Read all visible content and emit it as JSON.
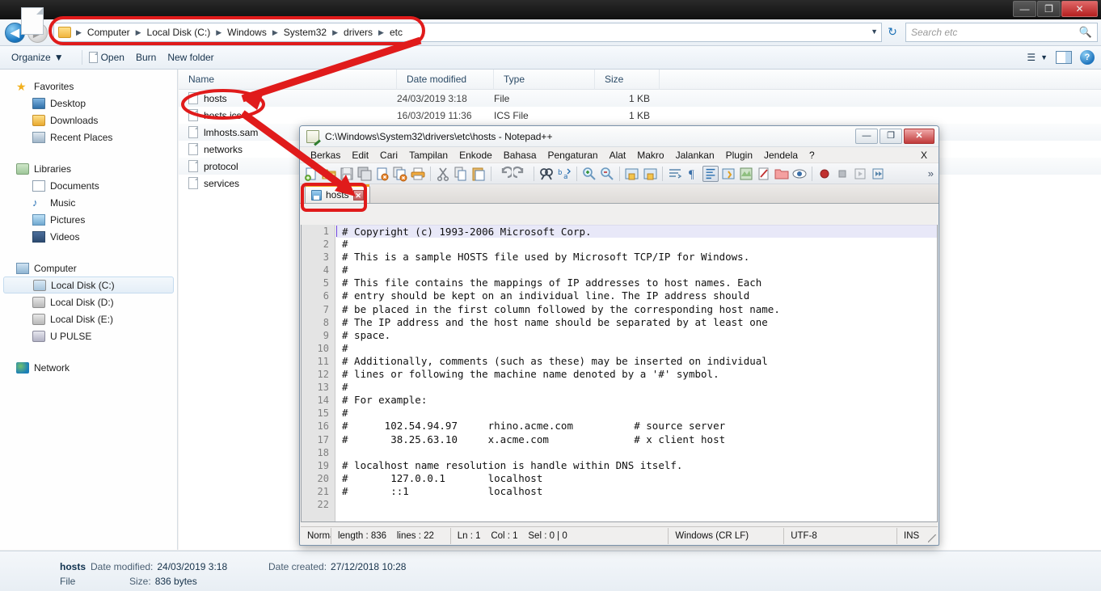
{
  "explorer": {
    "window_controls": {
      "minimize": "—",
      "maximize": "❐",
      "close": "✕"
    },
    "breadcrumb": [
      "Computer",
      "Local Disk (C:)",
      "Windows",
      "System32",
      "drivers",
      "etc"
    ],
    "search": {
      "placeholder": "Search etc"
    },
    "toolbar": {
      "organize": "Organize",
      "organize_caret": "▼",
      "open": "Open",
      "burn": "Burn",
      "new_folder": "New folder"
    },
    "sidebar": {
      "groups": [
        {
          "header": "Favorites",
          "icon": "star-icon",
          "items": [
            {
              "label": "Desktop",
              "icon": "desktop-icon"
            },
            {
              "label": "Downloads",
              "icon": "downloads-icon"
            },
            {
              "label": "Recent Places",
              "icon": "recent-places-icon"
            }
          ]
        },
        {
          "header": "Libraries",
          "icon": "libraries-icon",
          "items": [
            {
              "label": "Documents",
              "icon": "documents-icon"
            },
            {
              "label": "Music",
              "icon": "music-icon"
            },
            {
              "label": "Pictures",
              "icon": "pictures-icon"
            },
            {
              "label": "Videos",
              "icon": "videos-icon"
            }
          ]
        },
        {
          "header": "Computer",
          "icon": "computer-icon",
          "items": [
            {
              "label": "Local Disk (C:)",
              "icon": "hdd-system-icon",
              "selected": true
            },
            {
              "label": "Local Disk (D:)",
              "icon": "hdd-icon"
            },
            {
              "label": "Local Disk (E:)",
              "icon": "hdd-icon"
            },
            {
              "label": "U PULSE",
              "icon": "usb-drive-icon"
            }
          ]
        },
        {
          "header": "Network",
          "icon": "network-icon",
          "items": []
        }
      ]
    },
    "columns": [
      "Name",
      "Date modified",
      "Type",
      "Size"
    ],
    "files": [
      {
        "name": "hosts",
        "date": "24/03/2019 3:18",
        "type": "File",
        "size": "1 KB"
      },
      {
        "name": "hosts.ics",
        "date": "16/03/2019 11:36",
        "type": "ICS File",
        "size": "1 KB"
      },
      {
        "name": "lmhosts.sam",
        "date": "",
        "type": "",
        "size": ""
      },
      {
        "name": "networks",
        "date": "",
        "type": "",
        "size": ""
      },
      {
        "name": "protocol",
        "date": "",
        "type": "",
        "size": ""
      },
      {
        "name": "services",
        "date": "",
        "type": "",
        "size": ""
      }
    ],
    "details": {
      "name": "hosts",
      "date_modified_label": "Date modified:",
      "date_modified_value": "24/03/2019 3:18",
      "date_created_label": "Date created:",
      "date_created_value": "27/12/2018 10:28",
      "type": "File",
      "size_label": "Size:",
      "size_value": "836 bytes"
    }
  },
  "notepadpp": {
    "title": "C:\\Windows\\System32\\drivers\\etc\\hosts - Notepad++",
    "window_controls": {
      "minimize": "—",
      "maximize": "❐",
      "close": "✕"
    },
    "menu": [
      "Berkas",
      "Edit",
      "Cari",
      "Tampilan",
      "Enkode",
      "Bahasa",
      "Pengaturan",
      "Alat",
      "Makro",
      "Jalankan",
      "Plugin",
      "Jendela",
      "?"
    ],
    "menu_close": "X",
    "toolbar_overflow": "»",
    "tab": {
      "label": "hosts",
      "close": "✕"
    },
    "lines": [
      "# Copyright (c) 1993-2006 Microsoft Corp.",
      "#",
      "# This is a sample HOSTS file used by Microsoft TCP/IP for Windows.",
      "#",
      "# This file contains the mappings of IP addresses to host names. Each",
      "# entry should be kept on an individual line. The IP address should",
      "# be placed in the first column followed by the corresponding host name.",
      "# The IP address and the host name should be separated by at least one",
      "# space.",
      "#",
      "# Additionally, comments (such as these) may be inserted on individual",
      "# lines or following the machine name denoted by a '#' symbol.",
      "#",
      "# For example:",
      "#",
      "#      102.54.94.97     rhino.acme.com          # source server",
      "#       38.25.63.10     x.acme.com              # x client host",
      "",
      "# localhost name resolution is handle within DNS itself.",
      "#       127.0.0.1       localhost",
      "#       ::1             localhost",
      ""
    ],
    "status": {
      "mode": "Norma",
      "length": "length : 836",
      "lines": "lines : 22",
      "ln": "Ln : 1",
      "col": "Col : 1",
      "sel": "Sel : 0 | 0",
      "eol": "Windows (CR LF)",
      "encoding": "UTF-8",
      "insert": "INS"
    }
  },
  "annotations": {
    "color": "#e01b1b"
  }
}
